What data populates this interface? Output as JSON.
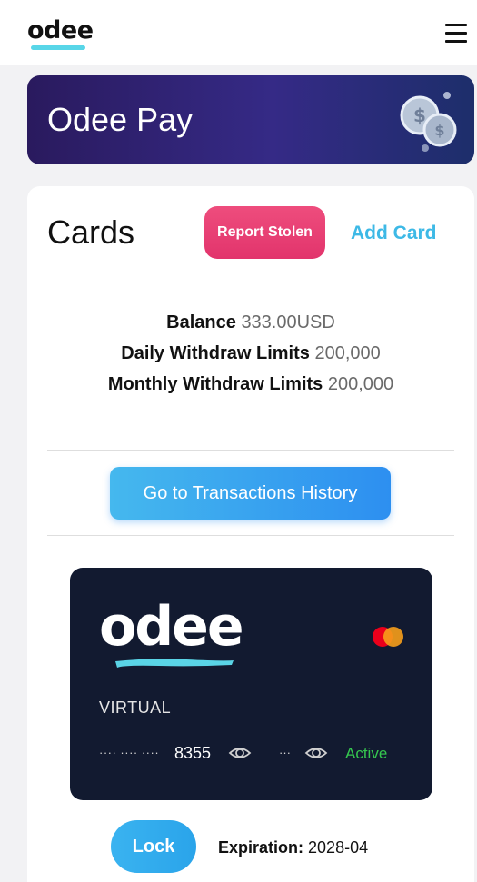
{
  "header": {
    "logo": "odee",
    "menu_icon": "hamburger-menu-icon"
  },
  "banner": {
    "title": "Odee Pay",
    "image_icon": "coins-icon"
  },
  "cards_section": {
    "heading": "Cards",
    "report_stolen_label": "Report Stolen",
    "add_card_label": "Add Card",
    "balance": {
      "label": "Balance",
      "value": "333.00USD"
    },
    "daily_limit": {
      "label": "Daily Withdraw Limits",
      "value": "200,000"
    },
    "monthly_limit": {
      "label": "Monthly Withdraw Limits",
      "value": "200,000"
    },
    "history_button_label": "Go to Transactions History"
  },
  "card": {
    "brand_logo": "odee",
    "network_icon": "mastercard-icon",
    "type": "VIRTUAL",
    "masked_number": "···· ···· ····",
    "last4": "8355",
    "masked_cvv": "···",
    "status": "Active",
    "status_color": "#35c74f",
    "show_number_icon": "eye-icon",
    "show_cvv_icon": "eye-icon"
  },
  "card_actions": {
    "lock_label": "Lock",
    "expiration_label": "Expiration:",
    "expiration_value": "2028-04"
  },
  "colors": {
    "accent_blue": "#3db9e6",
    "report_pink": "#e2346c",
    "card_bg": "#121a30"
  }
}
